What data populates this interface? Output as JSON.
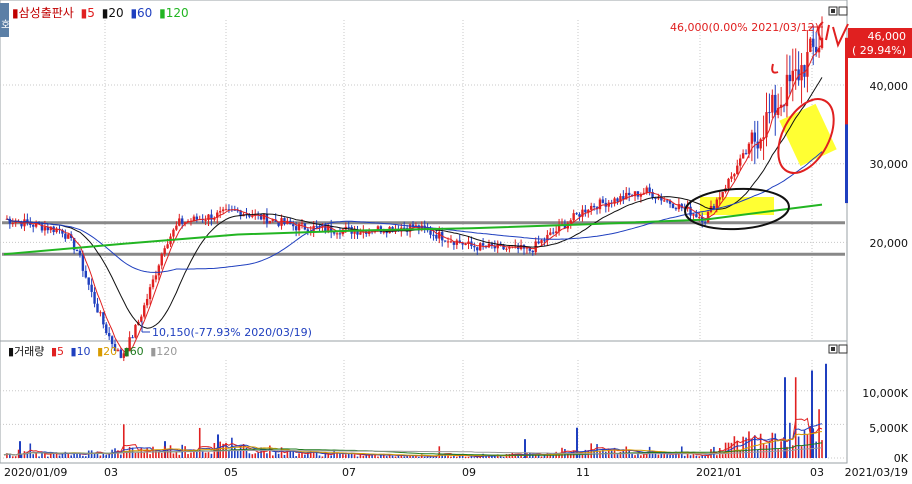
{
  "corner_badge": "호",
  "price_legend": {
    "marker": "▮",
    "name": "삼성출판사",
    "items": [
      {
        "label": "5",
        "color": "#e02020"
      },
      {
        "label": "20",
        "color": "#111111"
      },
      {
        "label": "60",
        "color": "#1f3fbf"
      },
      {
        "label": "120",
        "color": "#22b522"
      }
    ]
  },
  "volume_legend": {
    "marker": "▮",
    "name": "거래량",
    "items": [
      {
        "label": "5",
        "color": "#e02020"
      },
      {
        "label": "10",
        "color": "#1f3fbf"
      },
      {
        "label": "20",
        "color": "#d79b00"
      },
      {
        "label": "60",
        "color": "#1f7a1f"
      },
      {
        "label": "120",
        "color": "#999999"
      }
    ]
  },
  "annotations": {
    "high_label": "46,000(0.00% 2021/03/12)",
    "low_label": "10,150(-77.93% 2020/03/19)",
    "current_price": "46,000",
    "current_change": "( 29.94%)"
  },
  "price_axis_labels": [
    "40,000",
    "30,000",
    "20,000"
  ],
  "volume_axis_labels": [
    "10,000K",
    "5,000K",
    "0K"
  ],
  "date_labels": [
    "2020/01/09",
    "03",
    "05",
    "07",
    "09",
    "11",
    "2021/01",
    "03",
    "2021/03/19"
  ],
  "colors": {
    "up": "#e02020",
    "down": "#1f3fbf",
    "ma120": "#22b522",
    "highlight": "#ffff33",
    "hline": "#888888"
  },
  "chart_data": [
    {
      "type": "candlestick",
      "title": "삼성출판사",
      "x_range": [
        "2020/01/09",
        "2021/03/19"
      ],
      "ylim": [
        10000,
        47000
      ],
      "y_ticks": [
        20000,
        30000,
        40000
      ],
      "grid": true,
      "moving_averages": [
        5,
        20,
        60,
        120
      ],
      "horizontal_lines": [
        22500,
        18500
      ],
      "series": [
        {
          "name": "close",
          "x": [
            "2020/01",
            "2020/02",
            "2020/03",
            "2020/04",
            "2020/05",
            "2020/06",
            "2020/07",
            "2020/08",
            "2020/09",
            "2020/10",
            "2020/11",
            "2020/12",
            "2021/01",
            "2021/02",
            "2021/03"
          ],
          "values": [
            23000,
            21500,
            11500,
            22500,
            24000,
            22000,
            21500,
            22000,
            19500,
            19000,
            24500,
            26500,
            23000,
            35000,
            46000
          ]
        },
        {
          "name": "120",
          "x": [
            "2020/01",
            "2020/03",
            "2020/05",
            "2020/07",
            "2020/09",
            "2020/11",
            "2021/01",
            "2021/03"
          ],
          "values": [
            18500,
            19800,
            21000,
            21500,
            21800,
            22300,
            22900,
            24800
          ]
        }
      ],
      "annotations": [
        {
          "label": "46,000(0.00% 2021/03/12)",
          "x": "2021/03/12",
          "y": 46000
        },
        {
          "label": "10,150(-77.93% 2020/03/19)",
          "x": "2020/03/19",
          "y": 10150
        }
      ]
    },
    {
      "type": "bar",
      "title": "거래량",
      "ylim": [
        0,
        14000
      ],
      "y_ticks": [
        0,
        5000,
        10000
      ],
      "unit": "K",
      "moving_averages": [
        5,
        10,
        20,
        60,
        120
      ],
      "series": [
        {
          "name": "volume",
          "x": [
            "2020/01",
            "2020/02",
            "2020/03",
            "2020/04",
            "2020/05",
            "2020/06",
            "2020/07",
            "2020/08",
            "2020/09",
            "2020/10",
            "2020/11",
            "2020/12",
            "2021/01",
            "2021/02",
            "2021/03"
          ],
          "values": [
            800,
            600,
            1200,
            1500,
            1800,
            900,
            500,
            400,
            400,
            600,
            1500,
            800,
            600,
            4000,
            5000
          ]
        }
      ]
    }
  ]
}
